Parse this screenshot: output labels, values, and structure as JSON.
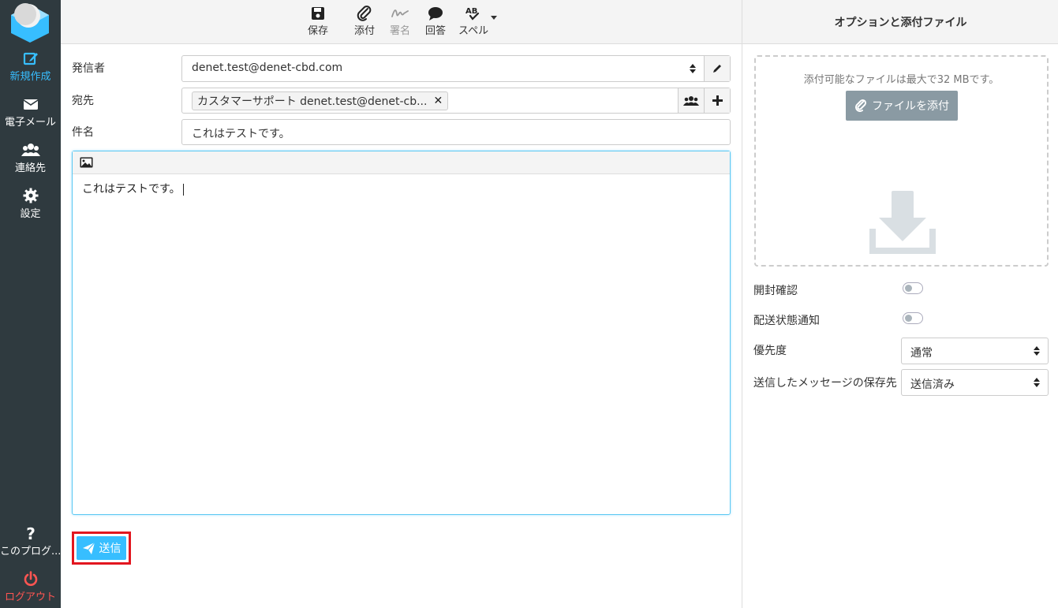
{
  "sidebar": {
    "items": [
      {
        "label": "新規作成",
        "icon": "compose-icon"
      },
      {
        "label": "電子メール",
        "icon": "envelope-icon"
      },
      {
        "label": "連絡先",
        "icon": "users-icon"
      },
      {
        "label": "設定",
        "icon": "gear-icon"
      }
    ],
    "about_label": "このプログ...",
    "logout_label": "ログアウト"
  },
  "toolbar": {
    "save": "保存",
    "attach": "添付",
    "signature": "署名",
    "responses": "回答",
    "spell": "スペル"
  },
  "form": {
    "from_label": "発信者",
    "from_value": "denet.test@denet-cbd.com",
    "to_label": "宛先",
    "to_recipient": "カスタマーサポート denet.test@denet-cb...",
    "subject_label": "件名",
    "subject_value": "これはテストです。",
    "body": "これはテストです。",
    "send_label": "送信"
  },
  "options_panel": {
    "title": "オプションと添付ファイル",
    "dropzone_text": "添付可能なファイルは最大で32 MBです。",
    "attach_button": "ファイルを添付",
    "read_receipt_label": "開封確認",
    "read_receipt_on": false,
    "dsn_label": "配送状態通知",
    "dsn_on": false,
    "priority_label": "優先度",
    "priority_value": "通常",
    "save_sent_label": "送信したメッセージの保存先",
    "save_sent_value": "送信済み"
  },
  "colors": {
    "sidebar_bg": "#2f3a3f",
    "accent": "#37beff",
    "logout": "#ff5552",
    "highlight_border": "#e2161f"
  }
}
